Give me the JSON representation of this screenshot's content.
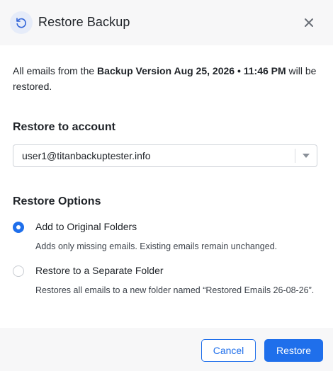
{
  "dialog": {
    "title": "Restore Backup",
    "header_icon": "restore-icon",
    "close_icon": "close-icon"
  },
  "description": {
    "prefix": "All emails from the ",
    "backup_version": "Backup Version Aug 25, 2026 • 11:46 PM",
    "suffix": " will be restored."
  },
  "account_section": {
    "title": "Restore to account",
    "selected_account": "user1@titanbackuptester.info"
  },
  "options_section": {
    "title": "Restore Options",
    "options": [
      {
        "label": "Add to Original Folders",
        "help": "Adds only missing emails. Existing emails remain unchanged.",
        "checked": true
      },
      {
        "label": "Restore to a Separate Folder",
        "help": "Restores all emails to a new folder named “Restored Emails 26-08-26”.",
        "checked": false
      }
    ]
  },
  "footer": {
    "cancel_label": "Cancel",
    "restore_label": "Restore"
  },
  "colors": {
    "accent": "#1f6feb",
    "header_bg": "#f7f7f8",
    "icon_bg": "#e6ecf9"
  }
}
